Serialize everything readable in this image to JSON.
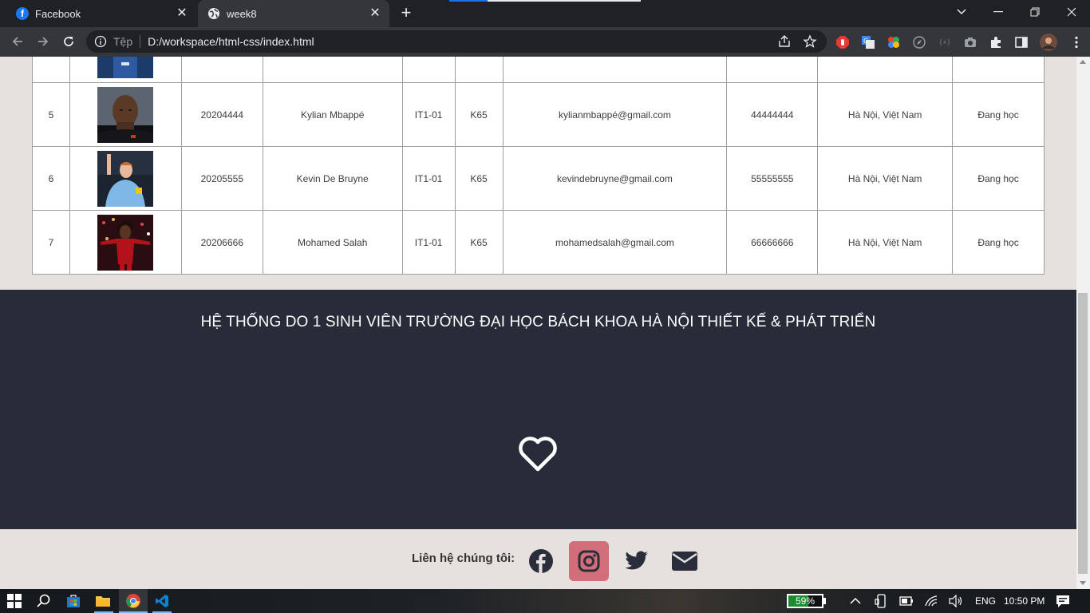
{
  "browser": {
    "tabs": [
      {
        "title": "Facebook",
        "favicon": "facebook-icon",
        "active": false
      },
      {
        "title": "week8",
        "favicon": "globe-icon",
        "active": true
      }
    ],
    "address": {
      "scheme_label": "Tệp",
      "url": "D:/workspace/html-css/index.html"
    }
  },
  "students": [
    {
      "stt": "5",
      "photo": "kylian-mbappe-photo",
      "mssv": "20204444",
      "name": "Kylian Mbappé",
      "class": "IT1-01",
      "course": "K65",
      "email": "kylianmbappé@gmail.com",
      "phone": "44444444",
      "address": "Hà Nội, Việt Nam",
      "status": "Đang học"
    },
    {
      "stt": "6",
      "photo": "kevin-de-bruyne-photo",
      "mssv": "20205555",
      "name": "Kevin De Bruyne",
      "class": "IT1-01",
      "course": "K65",
      "email": "kevindebruyne@gmail.com",
      "phone": "55555555",
      "address": "Hà Nội, Việt Nam",
      "status": "Đang học"
    },
    {
      "stt": "7",
      "photo": "mohamed-salah-photo",
      "mssv": "20206666",
      "name": "Mohamed Salah",
      "class": "IT1-01",
      "course": "K65",
      "email": "mohamedsalah@gmail.com",
      "phone": "66666666",
      "address": "Hà Nội, Việt Nam",
      "status": "Đang học"
    }
  ],
  "footer": {
    "title": "HỆ THỐNG DO 1 SINH VIÊN TRƯỜNG ĐẠI HỌC BÁCH KHOA HÀ NỘI THIẾT KẾ & PHÁT TRIỂN",
    "heart_icon": "heart-icon",
    "contact_label": "Liên hệ chúng tôi:",
    "socials": [
      "facebook-icon",
      "instagram-icon",
      "twitter-icon",
      "envelope-icon"
    ],
    "accent_color": "#d16e7a",
    "background_color": "#282b38"
  },
  "taskbar": {
    "battery_percent": "59%",
    "battery_level": 0.59,
    "language": "ENG",
    "time": "10:50 PM"
  }
}
